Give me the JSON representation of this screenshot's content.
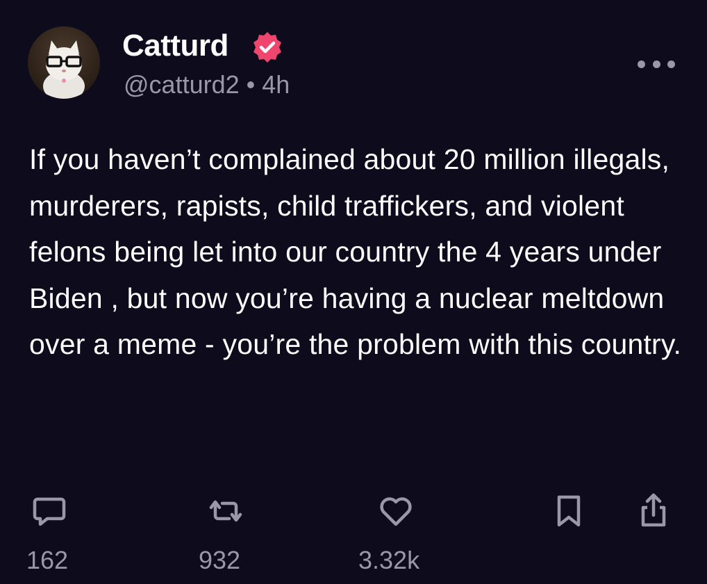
{
  "author": {
    "name": "Catturd",
    "handle": "@catturd2",
    "separator": "•",
    "time_ago": "4h",
    "verified": true
  },
  "post": {
    "text": "If you haven’t complained about 20 million illegals, murderers, rapists, child traffickers, and violent felons being let into our country the 4 years under Biden , but now you’re having a nuclear meltdown over a meme - you’re the problem with this country."
  },
  "actions": {
    "replies": "162",
    "reposts": "932",
    "likes": "3.32k"
  },
  "icons": {
    "more": "more-horizontal-icon",
    "reply": "comment-bubble-icon",
    "repost": "repost-arrows-icon",
    "like": "heart-icon",
    "bookmark": "bookmark-icon",
    "share": "share-icon"
  },
  "colors": {
    "background": "#0d0b1c",
    "text": "#ffffff",
    "muted": "#9a97a8",
    "verified_badge": "#f0466e"
  }
}
